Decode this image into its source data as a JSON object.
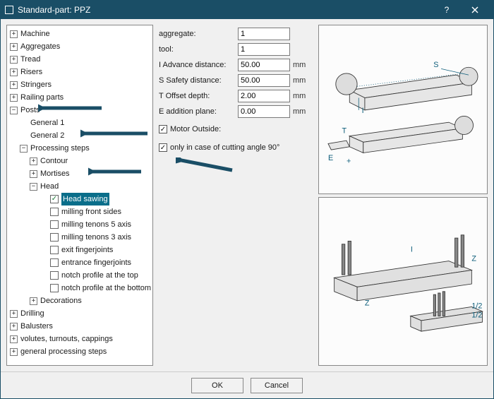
{
  "window": {
    "title": "Standard-part: PPZ"
  },
  "tree": {
    "items": [
      "Machine",
      "Aggregates",
      "Tread",
      "Risers",
      "Stringers",
      "Railing parts"
    ],
    "posts": {
      "label": "Posts",
      "general1": "General  1",
      "general2": "General  2",
      "proc": {
        "label": "Processing steps",
        "contour": "Contour",
        "mortises": "Mortises",
        "head": {
          "label": "Head",
          "head_sawing": "Head sawing",
          "milling_front": "milling front sides",
          "tenons5": "milling tenons 5 axis",
          "tenons3": "milling tenons 3 axis",
          "exitfj": "exit fingerjoints",
          "entrancefj": "entrance fingerjoints",
          "notch_top": "notch profile at the top",
          "notch_bottom": "notch profile at the bottom"
        },
        "decorations": "Decorations"
      }
    },
    "tail": [
      "Drilling",
      "Balusters",
      "volutes, turnouts, cappings",
      "general processing steps"
    ]
  },
  "params": {
    "aggregate": {
      "label": "aggregate:",
      "value": "1",
      "unit": ""
    },
    "tool": {
      "label": "tool:",
      "value": "1",
      "unit": ""
    },
    "advance": {
      "label": "I  Advance distance:",
      "value": "50.00",
      "unit": "mm"
    },
    "safety": {
      "label": "S  Safety distance:",
      "value": "50.00",
      "unit": "mm"
    },
    "offset": {
      "label": "T  Offset depth:",
      "value": "2.00",
      "unit": "mm"
    },
    "addition": {
      "label": "E  addition plane:",
      "value": "0.00",
      "unit": "mm"
    },
    "motor": {
      "label": "Motor Outside:",
      "checked": true
    },
    "cut90": {
      "label": "only in case of cutting angle 90°",
      "checked": true
    }
  },
  "buttons": {
    "ok": "OK",
    "cancel": "Cancel"
  }
}
